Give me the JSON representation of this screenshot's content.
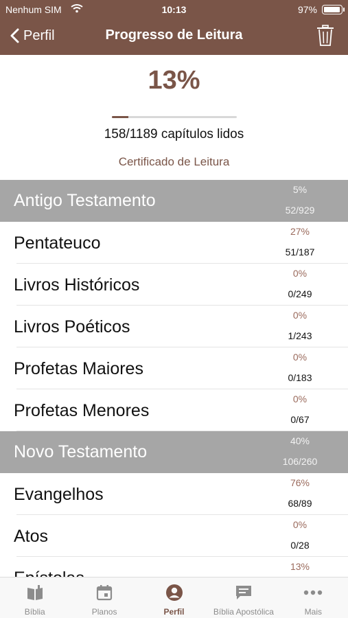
{
  "status": {
    "carrier": "Nenhum SIM",
    "time": "10:13",
    "battery": "97%"
  },
  "nav": {
    "back_label": "Perfil",
    "title": "Progresso de Leitura"
  },
  "summary": {
    "percent": "13%",
    "progress_fraction": 0.13,
    "chapters_text": "158/1189 capítulos lidos",
    "certificate_link": "Certificado de Leitura"
  },
  "sections": [
    {
      "name": "Antigo Testamento",
      "percent": "5%",
      "count": "52/929",
      "items": [
        {
          "name": "Pentateuco",
          "percent": "27%",
          "count": "51/187"
        },
        {
          "name": "Livros Históricos",
          "percent": "0%",
          "count": "0/249"
        },
        {
          "name": "Livros Poéticos",
          "percent": "0%",
          "count": "1/243"
        },
        {
          "name": "Profetas Maiores",
          "percent": "0%",
          "count": "0/183"
        },
        {
          "name": "Profetas Menores",
          "percent": "0%",
          "count": "0/67"
        }
      ]
    },
    {
      "name": "Novo Testamento",
      "percent": "40%",
      "count": "106/260",
      "items": [
        {
          "name": "Evangelhos",
          "percent": "76%",
          "count": "68/89"
        },
        {
          "name": "Atos",
          "percent": "0%",
          "count": "0/28"
        },
        {
          "name": "Epístolas",
          "percent": "13%",
          "count": ""
        }
      ]
    }
  ],
  "tabs": [
    {
      "label": "Bíblia",
      "icon": "bible-icon",
      "active": false
    },
    {
      "label": "Planos",
      "icon": "calendar-icon",
      "active": false
    },
    {
      "label": "Perfil",
      "icon": "profile-icon",
      "active": true
    },
    {
      "label": "Bíblia Apostólica",
      "icon": "chat-icon",
      "active": false
    },
    {
      "label": "Mais",
      "icon": "more-icon",
      "active": false
    }
  ],
  "colors": {
    "brand": "#7a5548",
    "section_bg": "#a6a6a6",
    "row_percent": "#9a6a5c"
  }
}
